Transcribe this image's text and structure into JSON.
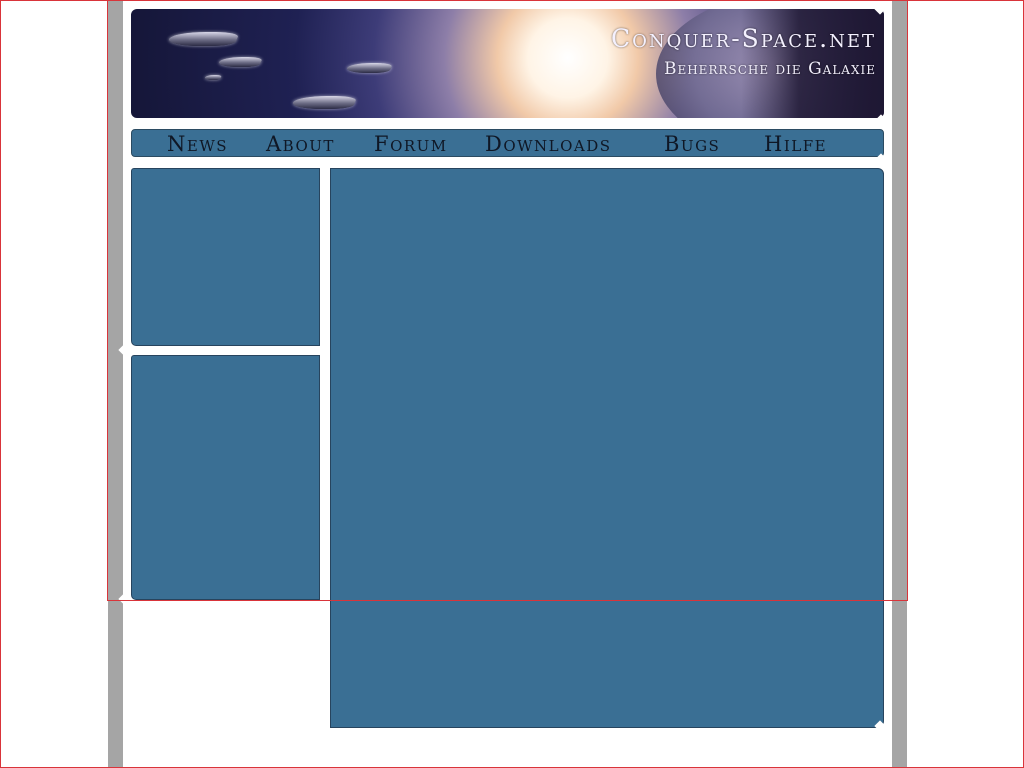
{
  "site": {
    "title": "Conquer-Space.net",
    "subtitle": "Beherrsche die Galaxie"
  },
  "nav": {
    "items": [
      {
        "label": "News"
      },
      {
        "label": "About"
      },
      {
        "label": "Forum"
      },
      {
        "label": "Downloads"
      },
      {
        "label": "Bugs"
      },
      {
        "label": "Hilfe"
      }
    ]
  },
  "colors": {
    "panel": "#3a6f94",
    "rail": "#a5a5a5",
    "outline": "#d9343a",
    "nav_text": "#0f1725",
    "banner_text": "#f4f1ff"
  },
  "icons": {
    "banner_art": "spaceship-fleet-illustration"
  }
}
